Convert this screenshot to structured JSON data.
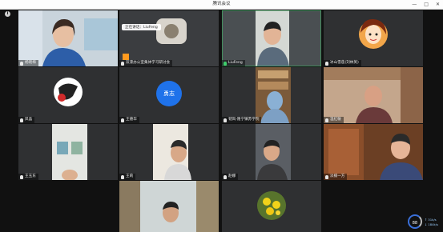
{
  "window": {
    "title": "腾讯会议",
    "minimize": "—",
    "maximize": "□",
    "close": "✕"
  },
  "info_badge": "i",
  "speaking_banner": "正在讲话：LiuFeng",
  "participants": [
    {
      "name": "杨晓梅",
      "mic": "muted",
      "avatar_initials": ""
    },
    {
      "name": "双滦办公室集体学习研讨会",
      "mic": "active",
      "avatar_initials": ""
    },
    {
      "name": "LiuFeng",
      "mic": "speaking",
      "avatar_initials": ""
    },
    {
      "name": "冰山雪莲(刘林英)",
      "mic": "muted",
      "avatar_initials": ""
    },
    {
      "name": "凤晶",
      "mic": "muted",
      "avatar_initials": ""
    },
    {
      "name": "王德华",
      "mic": "muted",
      "avatar_initials": "勇志"
    },
    {
      "name": "韧岚-隆宁镇苏学院",
      "mic": "muted",
      "avatar_initials": ""
    },
    {
      "name": "温红敏",
      "mic": "muted",
      "avatar_initials": ""
    },
    {
      "name": "王玉东",
      "mic": "muted",
      "avatar_initials": ""
    },
    {
      "name": "王莉",
      "mic": "muted",
      "avatar_initials": ""
    },
    {
      "name": "赵娜",
      "mic": "muted",
      "avatar_initials": ""
    },
    {
      "name": "淡楠一方",
      "mic": "muted",
      "avatar_initials": ""
    }
  ],
  "network": {
    "gauge_value": "88",
    "upload": "↑ 31k/s",
    "download": "↓ 184k/s"
  },
  "colors": {
    "accent": "#1f72ea",
    "speaking_mic": "#3fcf6c"
  }
}
